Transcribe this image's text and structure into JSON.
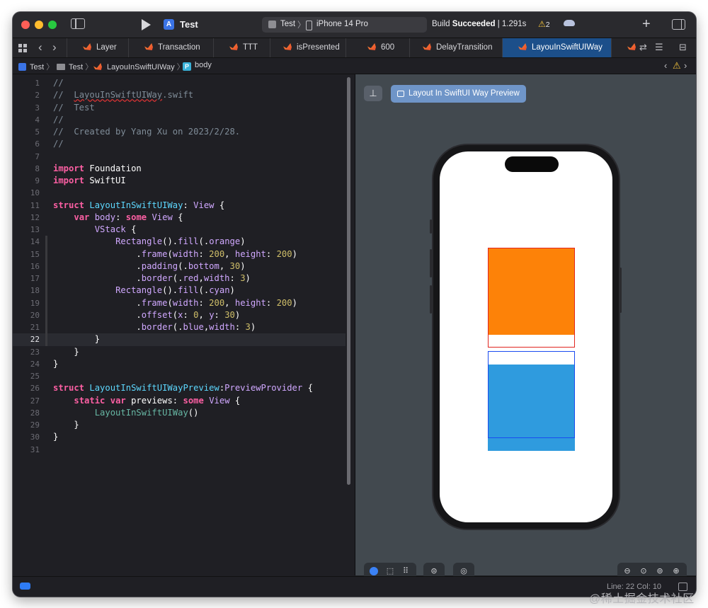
{
  "window": {
    "title": "Test"
  },
  "toolbar": {
    "project_name": "Test",
    "scheme_target": "Test",
    "scheme_separator": "〉",
    "scheme_device": "iPhone 14 Pro",
    "build_label": "Build",
    "build_status": "Succeeded",
    "build_time": " | 1.291s",
    "warning_count": "2",
    "plus_label": "+"
  },
  "tabs": [
    {
      "label": "Layer",
      "active": false
    },
    {
      "label": "Transaction",
      "active": false
    },
    {
      "label": "TTT",
      "active": false
    },
    {
      "label": "isPresented",
      "active": false
    },
    {
      "label": "600",
      "active": false
    },
    {
      "label": "DelayTransition",
      "active": false
    },
    {
      "label": "LayouInSwiftUIWay",
      "active": true
    }
  ],
  "breadcrumb": {
    "project": "Test",
    "sep": "〉",
    "folder": "Test",
    "file": "LayouInSwiftUIWay",
    "symbol_badge": "P",
    "symbol": "body"
  },
  "editor": {
    "current_line": 22,
    "lines": [
      {
        "n": "1",
        "t": "//"
      },
      {
        "n": "2",
        "t": "//  LayouInSwiftUIWay.swift"
      },
      {
        "n": "3",
        "t": "//  Test"
      },
      {
        "n": "4",
        "t": "//"
      },
      {
        "n": "5",
        "t": "//  Created by Yang Xu on 2023/2/28."
      },
      {
        "n": "6",
        "t": "//"
      },
      {
        "n": "7",
        "t": ""
      },
      {
        "n": "8",
        "t": "import Foundation"
      },
      {
        "n": "9",
        "t": "import SwiftUI"
      },
      {
        "n": "10",
        "t": ""
      },
      {
        "n": "11",
        "t": "struct LayoutInSwiftUIWay: View {"
      },
      {
        "n": "12",
        "t": "    var body: some View {"
      },
      {
        "n": "13",
        "t": "        VStack {"
      },
      {
        "n": "14",
        "t": "            Rectangle().fill(.orange)"
      },
      {
        "n": "15",
        "t": "                .frame(width: 200, height: 200)"
      },
      {
        "n": "16",
        "t": "                .padding(.bottom, 30)"
      },
      {
        "n": "17",
        "t": "                .border(.red,width: 3)"
      },
      {
        "n": "18",
        "t": "            Rectangle().fill(.cyan)"
      },
      {
        "n": "19",
        "t": "                .frame(width: 200, height: 200)"
      },
      {
        "n": "20",
        "t": "                .offset(x: 0, y: 30)"
      },
      {
        "n": "21",
        "t": "                .border(.blue,width: 3)"
      },
      {
        "n": "22",
        "t": "        }"
      },
      {
        "n": "23",
        "t": "    }"
      },
      {
        "n": "24",
        "t": "}"
      },
      {
        "n": "25",
        "t": ""
      },
      {
        "n": "26",
        "t": "struct LayoutInSwiftUIWayPreview:PreviewProvider {"
      },
      {
        "n": "27",
        "t": "    static var previews: some View {"
      },
      {
        "n": "28",
        "t": "        LayoutInSwiftUIWay()"
      },
      {
        "n": "29",
        "t": "    }"
      },
      {
        "n": "30",
        "t": "}"
      },
      {
        "n": "31",
        "t": ""
      }
    ]
  },
  "canvas": {
    "preview_label": "Layout In SwiftUI Way Preview",
    "pin_icon": "pin-icon",
    "device": "iPhone 14 Pro",
    "orange_color": "#fd8208",
    "cyan_color": "#2f9bde",
    "red_border": "#e1251f",
    "blue_border": "#1a4bf0"
  },
  "status": {
    "cursor": "Line: 22  Col: 10"
  },
  "watermark": "@稀土掘金技术社区"
}
